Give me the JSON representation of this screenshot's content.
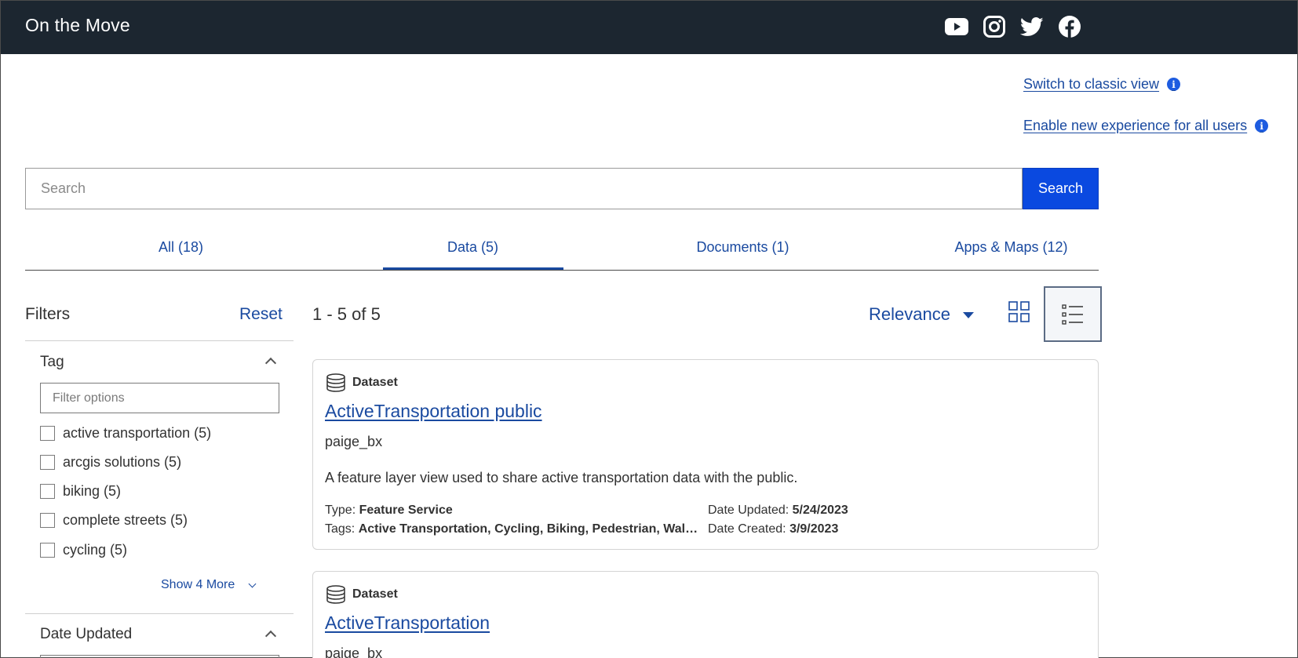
{
  "header": {
    "site_title": "On the Move",
    "social_icons": [
      "youtube-icon",
      "instagram-icon",
      "twitter-icon",
      "facebook-icon"
    ]
  },
  "links": {
    "classic_view": "Switch to classic view",
    "enable_new": "Enable new experience for all users"
  },
  "search": {
    "placeholder": "Search",
    "value": "",
    "button_label": "Search"
  },
  "tabs": [
    {
      "label": "All (18)",
      "selected": false
    },
    {
      "label": "Data (5)",
      "selected": true
    },
    {
      "label": "Documents (1)",
      "selected": false
    },
    {
      "label": "Apps & Maps (12)",
      "selected": false
    }
  ],
  "filters": {
    "title": "Filters",
    "reset_label": "Reset",
    "tag": {
      "title": "Tag",
      "filter_placeholder": "Filter options",
      "options": [
        "active transportation (5)",
        "arcgis solutions (5)",
        "biking (5)",
        "complete streets (5)",
        "cycling (5)"
      ],
      "show_more": "Show 4 More"
    },
    "date_updated": {
      "title": "Date Updated"
    }
  },
  "results": {
    "count_text": "1 - 5 of 5",
    "sort_label": "Relevance",
    "view_mode": "list",
    "items": [
      {
        "type": "Dataset",
        "title": "ActiveTransportation public",
        "owner": "paige_bx",
        "description": "A feature layer view used to share active transportation data with the public.",
        "type_label": "Type:",
        "type_value": "Feature Service",
        "tags_label": "Tags:",
        "tags_value": "Active Transportation, Cycling, Biking, Pedestrian, Wal…",
        "updated_label": "Date Updated:",
        "updated_value": "5/24/2023",
        "created_label": "Date Created:",
        "created_value": "3/9/2023"
      },
      {
        "type": "Dataset",
        "title": "ActiveTransportation",
        "owner": "paige_bx"
      }
    ]
  },
  "colors": {
    "header_bg": "#1c2630",
    "link_blue": "#1a4aa0",
    "button_blue": "#0a49e0"
  }
}
